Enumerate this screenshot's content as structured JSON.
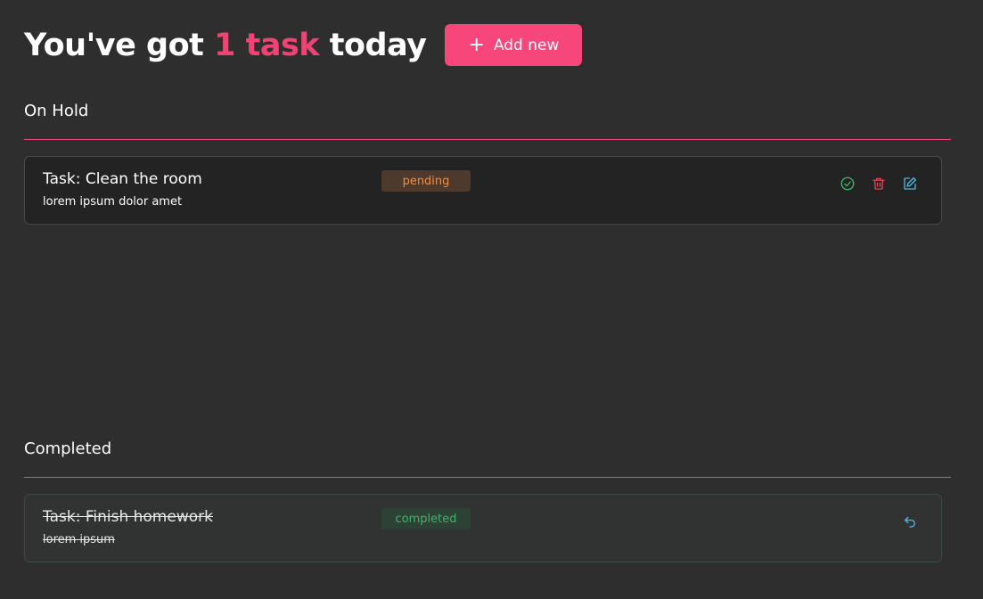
{
  "header": {
    "headline_prefix": "You've got",
    "headline_count": "1 task",
    "headline_suffix": "today",
    "add_button_label": "Add new",
    "add_button_icon": "plus-icon"
  },
  "sections": {
    "on_hold": {
      "title": "On Hold",
      "tasks": [
        {
          "title": "Task: Clean the room",
          "description": "lorem ipsum dolor amet",
          "status": "pending",
          "actions": [
            "complete-icon",
            "trash-icon",
            "edit-icon"
          ]
        }
      ]
    },
    "completed": {
      "title": "Completed",
      "tasks": [
        {
          "title": "Task: Finish homework",
          "description": "lorem ipsum",
          "status": "completed",
          "actions": [
            "undo-icon"
          ]
        }
      ]
    }
  },
  "colors": {
    "background": "#2e2e2e",
    "accent": "#f04374",
    "pending": "#ee8d4a",
    "completed": "#3fb46a",
    "danger": "#e0455a",
    "info": "#4fb8e0"
  }
}
